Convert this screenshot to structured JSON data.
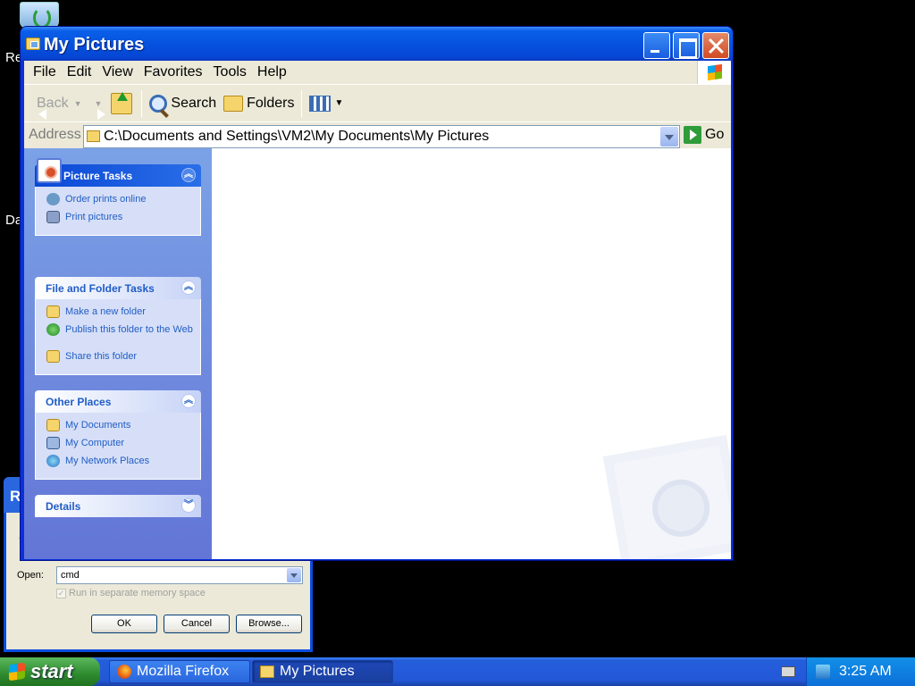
{
  "desktop": {
    "icon_labels": [
      "Re",
      "Da"
    ]
  },
  "run_dialog": {
    "title_fragment": "R",
    "open_label": "Open:",
    "open_value": "cmd",
    "checkbox_label": "Run in separate memory space",
    "ok_label": "OK",
    "cancel_label": "Cancel",
    "browse_label": "Browse..."
  },
  "window": {
    "title": "My Pictures",
    "menu": [
      "File",
      "Edit",
      "View",
      "Favorites",
      "Tools",
      "Help"
    ],
    "toolbar": {
      "back_label": "Back",
      "search_label": "Search",
      "folders_label": "Folders"
    },
    "address": {
      "label": "Address",
      "value": "C:\\Documents and Settings\\VM2\\My Documents\\My Pictures",
      "go_label": "Go"
    },
    "panels": [
      {
        "title": "Picture Tasks",
        "items": [
          "Order prints online",
          "Print pictures"
        ]
      },
      {
        "title": "File and Folder Tasks",
        "items": [
          "Make a new folder",
          "Publish this folder to the Web",
          "Share this folder"
        ]
      },
      {
        "title": "Other Places",
        "items": [
          "My Documents",
          "My Computer",
          "My Network Places"
        ]
      },
      {
        "title": "Details",
        "items": []
      }
    ]
  },
  "taskbar": {
    "start_label": "start",
    "tasks": [
      "Mozilla Firefox",
      "My Pictures"
    ],
    "clock": "3:25 AM"
  }
}
